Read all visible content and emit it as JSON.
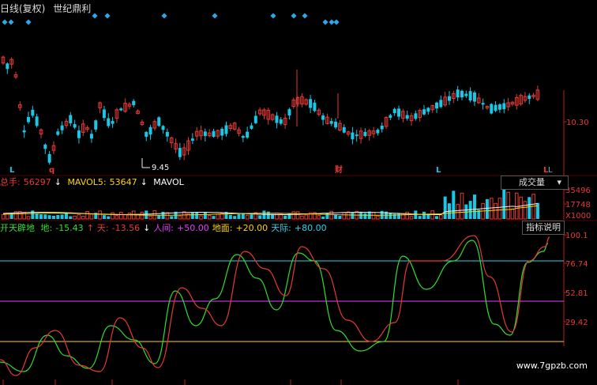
{
  "header": {
    "period": "日线(复权)",
    "stock_name": "世纪鼎利"
  },
  "colors": {
    "up": "#e53935",
    "down": "#19c7e6",
    "white": "#f0f0f0",
    "yellow": "#ffd400",
    "magenta": "#e040fb",
    "green": "#2ee02e",
    "cyan": "#29d3e8",
    "axis": "#b71c1c"
  },
  "price_panel": {
    "right_axis_label": "10.30",
    "low_marker": "9.45",
    "markers": [
      "L",
      "q",
      "财",
      "L",
      "L"
    ]
  },
  "volume_panel": {
    "total": {
      "label": "总手:",
      "value": "56297",
      "arrow": "↓"
    },
    "mavol5": {
      "label": "MAVOL5:",
      "value": "53647",
      "arrow": "↓"
    },
    "mavol10_label": "MAVOL",
    "axis_labels": [
      "35496",
      "17748",
      "X1000"
    ],
    "button_label": "成交量",
    "dropdown_arrow": "▾"
  },
  "indicator_panel": {
    "name": "开天辟地",
    "series": [
      {
        "label": "地:",
        "value": "-15.43",
        "arrow": "↑",
        "color": "#2ee02e"
      },
      {
        "label": "天:",
        "value": "-13.56",
        "arrow": "↓",
        "color": "#e53935"
      },
      {
        "label": "人间:",
        "value": "+50.00",
        "color": "#e040fb"
      },
      {
        "label": "地面:",
        "value": "+20.00",
        "color": "#ffd400"
      },
      {
        "label": "天际:",
        "value": "+80.00",
        "color": "#29d3e8"
      }
    ],
    "axis_labels": [
      "100.1",
      "76.74",
      "52.81",
      "29.42"
    ],
    "button_label": "指标说明"
  },
  "watermark": "www.7gpzb.com"
}
